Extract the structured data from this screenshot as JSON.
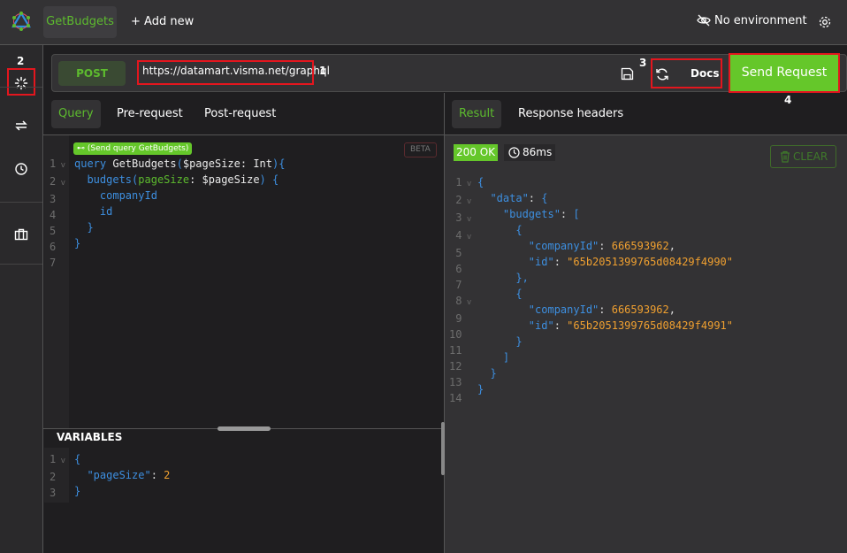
{
  "topbar": {
    "logo": "graphql-logo-icon",
    "active_tab": "GetBudgets",
    "add_new": "+ Add new",
    "environment": "No environment"
  },
  "annotations": {
    "a1": "1",
    "a2": "2",
    "a3": "3",
    "a4": "4"
  },
  "request": {
    "method": "POST",
    "url": "https://datamart.visma.net/graphql",
    "docs": "Docs",
    "send": "Send Request"
  },
  "left_tabs": [
    "Query",
    "Pre-request",
    "Post-request"
  ],
  "right_tabs": [
    "Result",
    "Response headers"
  ],
  "editor": {
    "run_hint": "⊷ (Send query GetBudgets)",
    "beta": "BETA",
    "lines": [
      [
        [
          "k",
          "query "
        ],
        [
          "n",
          "GetBudgets"
        ],
        [
          "p",
          "("
        ],
        [
          "n",
          "$pageSize"
        ],
        [
          "n",
          ": "
        ],
        [
          "n",
          "Int"
        ],
        [
          "p",
          "){"
        ]
      ],
      [
        [
          "k",
          "  budgets"
        ],
        [
          "p",
          "("
        ],
        [
          "g",
          "pageSize"
        ],
        [
          "n",
          ": "
        ],
        [
          "n",
          "$pageSize"
        ],
        [
          "p",
          ") {"
        ]
      ],
      [
        [
          "k",
          "    companyId"
        ]
      ],
      [
        [
          "k",
          "    id"
        ]
      ],
      [
        [
          "p",
          "  }"
        ]
      ],
      [
        [
          "p",
          "}"
        ]
      ],
      []
    ],
    "folds": [
      1,
      2
    ]
  },
  "variables": {
    "title": "VARIABLES",
    "lines": [
      [
        [
          "p",
          "{"
        ]
      ],
      [
        [
          "s",
          "  \"pageSize\""
        ],
        [
          "w",
          ": "
        ],
        [
          "num",
          "2"
        ]
      ],
      [
        [
          "p",
          "}"
        ]
      ]
    ],
    "folds": [
      1
    ]
  },
  "result": {
    "status": "200 OK",
    "time": "86ms",
    "clear": "CLEAR",
    "lines": [
      [
        [
          "p",
          "{"
        ]
      ],
      [
        [
          "s",
          "  \"data\""
        ],
        [
          "w",
          ": "
        ],
        [
          "p",
          "{"
        ]
      ],
      [
        [
          "s",
          "    \"budgets\""
        ],
        [
          "w",
          ": "
        ],
        [
          "p",
          "["
        ]
      ],
      [
        [
          "p",
          "      {"
        ]
      ],
      [
        [
          "s",
          "        \"companyId\""
        ],
        [
          "w",
          ": "
        ],
        [
          "num",
          "666593962"
        ],
        [
          "w",
          ","
        ]
      ],
      [
        [
          "s",
          "        \"id\""
        ],
        [
          "w",
          ": "
        ],
        [
          "str",
          "\"65b2051399765d08429f4990\""
        ]
      ],
      [
        [
          "p",
          "      },"
        ]
      ],
      [
        [
          "p",
          "      {"
        ]
      ],
      [
        [
          "s",
          "        \"companyId\""
        ],
        [
          "w",
          ": "
        ],
        [
          "num",
          "666593962"
        ],
        [
          "w",
          ","
        ]
      ],
      [
        [
          "s",
          "        \"id\""
        ],
        [
          "w",
          ": "
        ],
        [
          "str",
          "\"65b2051399765d08429f4991\""
        ]
      ],
      [
        [
          "p",
          "      }"
        ]
      ],
      [
        [
          "p",
          "    ]"
        ]
      ],
      [
        [
          "p",
          "  }"
        ]
      ],
      [
        [
          "p",
          "}"
        ]
      ]
    ],
    "folds": [
      1,
      2,
      3,
      4,
      8
    ]
  },
  "colors": {
    "accent": "#65c72a",
    "annotation_box": "#e3161e",
    "background": "#1f1e20",
    "panel": "#333234"
  }
}
